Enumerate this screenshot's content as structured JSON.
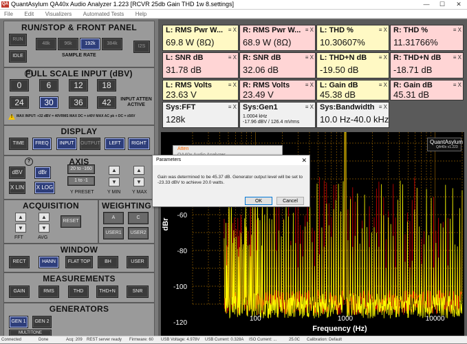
{
  "window": {
    "app_icon": "QA",
    "title": "QuantAsylum QA40x Audio Analyzer 1.223 [RCVR 25db Gain THD 1w 8.settings]",
    "minimize": "—",
    "maximize": "☐",
    "close": "✕"
  },
  "menu": [
    "File",
    "Edit",
    "Visualizers",
    "Automated Tests",
    "Help"
  ],
  "run_stop": {
    "title": "RUN/STOP & FRONT PANEL",
    "run": "RUN",
    "idle": "IDLE",
    "sample_rates": [
      "48k",
      "96k",
      "192k",
      "384k"
    ],
    "sample_rate_label": "SAMPLE RATE",
    "i2s": "I2S"
  },
  "full_scale": {
    "help_icon": "?",
    "title": "FULL SCALE INPUT (dBV)",
    "levels": [
      "0",
      "6",
      "12",
      "18",
      "24",
      "30",
      "36",
      "42"
    ],
    "atten_label": "INPUT ATTEN ACTIVE",
    "warning_icon": "!",
    "warning": "MAX INPUT: +32 dBV = 40VRMS   MAX DC = ±40V   MAX AC pk + DC = ±56V"
  },
  "display": {
    "title": "DISPLAY",
    "buttons": [
      "TIME",
      "FREQ",
      "INPUT",
      "OUTPUT",
      "LEFT",
      "RIGHT"
    ]
  },
  "axis": {
    "help_icon": "?",
    "title": "AXIS",
    "dbv": "dBV",
    "dbr": "dBr",
    "xlin": "X LIN",
    "xlog": "X LOG",
    "ypreset_a": "20 to -160",
    "ypreset_b": "1 to -1",
    "ypreset_label": "Y PRESET",
    "ymin_label": "Y MIN",
    "ymax_label": "Y MAX",
    "up": "▲",
    "down": "▼"
  },
  "acquisition": {
    "title": "ACQUISITION",
    "fft_label": "FFT",
    "avg_label": "AVG",
    "reset": "RESET"
  },
  "weighting": {
    "title": "WEIGHTING",
    "buttons": [
      "A",
      "C",
      "USER1",
      "USER2"
    ]
  },
  "window_fn": {
    "title": "WINDOW",
    "buttons": [
      "RECT",
      "HANN",
      "FLAT TOP",
      "BH",
      "USER"
    ]
  },
  "measurements": {
    "title": "MEASUREMENTS",
    "buttons": [
      "GAIN",
      "RMS",
      "THD",
      "THD+N",
      "SNR"
    ]
  },
  "generators": {
    "title": "GENERATORS",
    "buttons": [
      "GEN 1",
      "GEN 2",
      "MULTITONE"
    ]
  },
  "meters": [
    {
      "title": "L: RMS Pwr W...",
      "value": "69.8 W (8Ω)",
      "color": "#fff9c4"
    },
    {
      "title": "R: RMS Pwr W...",
      "value": "68.9 W (8Ω)",
      "color": "#ffd5d5"
    },
    {
      "title": "L: THD %",
      "value": "10.30607%",
      "color": "#fff9c4"
    },
    {
      "title": "R: THD %",
      "value": "11.31766%",
      "color": "#ffd5d5"
    },
    {
      "title": "L: SNR dB",
      "value": "31.78 dB",
      "color": "#ffd5d5"
    },
    {
      "title": "R: SNR dB",
      "value": "32.06 dB",
      "color": "#ffd5d5"
    },
    {
      "title": "L: THD+N dB",
      "value": "-19.50 dB",
      "color": "#fff9c4"
    },
    {
      "title": "R: THD+N dB",
      "value": "-18.71 dB",
      "color": "#ffd5d5"
    },
    {
      "title": "L: RMS Volts",
      "value": "23.63 V",
      "color": "#fff9c4"
    },
    {
      "title": "R: RMS Volts",
      "value": "23.49 V",
      "color": "#ffd5d5"
    },
    {
      "title": "L: Gain dB",
      "value": "45.38 dB",
      "color": "#fff9c4"
    },
    {
      "title": "R: Gain dB",
      "value": "45.31 dB",
      "color": "#ffd5d5"
    },
    {
      "title": "Sys:FFT",
      "value": "128k",
      "color": "#f0f0f0"
    },
    {
      "title": "Sys:Gen1",
      "value_line1": "1.0004 kHz",
      "value_line2": "-17.96 dBV / 126.4 mVrms",
      "color": "#f0f0f0"
    },
    {
      "title": "Sys:Bandwidth",
      "value": "10.0 Hz-40.0 kHz",
      "color": "#f0f0f0"
    }
  ],
  "meter_icons": "≡ X",
  "chart": {
    "badge_brand": "QuantAsylum",
    "badge_model": "QA40x v1.223",
    "ylabel": "dBr",
    "xlabel": "Frequency (Hz)",
    "y_ticks": [
      "-60",
      "-80",
      "-100",
      "-120"
    ],
    "x_ticks": [
      "100",
      "1000",
      "10000"
    ],
    "colors": {
      "left": "#ffff00",
      "right": "#cc0000",
      "grid": "#8b5a00",
      "labels": "#ffffff"
    }
  },
  "ghost_window": {
    "line1": "Atten",
    "line2": "QA40x Audio Analyzer"
  },
  "dialog": {
    "title": "Parameters",
    "close": "✕",
    "message": "Gain was determined to be 45.37 dB. Generator output level will be set to -23.33 dBV to achieve 20.0 watts.",
    "ok": "OK",
    "cancel": "Cancel"
  },
  "status": [
    {
      "text": "Connected"
    },
    {
      "text": "Done"
    },
    {
      "text": "Acq: 209"
    },
    {
      "text": "REST server ready"
    },
    {
      "text": "Firmware: 60"
    },
    {
      "text": "USB Voltage: 4.978V"
    },
    {
      "text": "USB Current: 0.328A"
    },
    {
      "text": "ISO Current: ..."
    },
    {
      "text": "25.0C"
    },
    {
      "text": "Calibration: Default"
    }
  ]
}
